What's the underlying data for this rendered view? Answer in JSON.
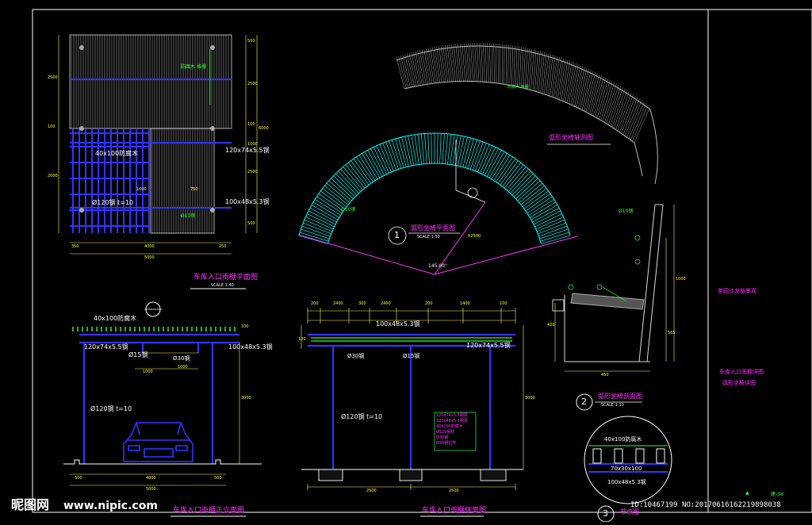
{
  "titles": {
    "plan_view": "车库入口雨棚平面图",
    "front_elevation": "车库入口雨棚正立面图",
    "side_elevation": "车库入口雨棚侧面图",
    "bench_plan": "弧形坐椅平面图",
    "bench_perspective": "弧形坐椅轴测图",
    "bench_section": "弧形坐椅剖面图",
    "detail": "节点图"
  },
  "scales": {
    "plan_view": "SCALE 1:40",
    "bench_plan": "SCALE 1:30",
    "bench_section": "SCALE 1:10"
  },
  "markers": {
    "m1": "1",
    "m2": "2",
    "m3": "3"
  },
  "plan_dims": {
    "bottom": [
      "350",
      "4000",
      "250"
    ],
    "total": "5000",
    "right": [
      "500",
      "2500",
      "100",
      "1000",
      "2500",
      "500"
    ],
    "right_total": "6000",
    "left": [
      "2500",
      "100",
      "2000"
    ],
    "inner": [
      "1600",
      "750",
      "1000",
      "1600"
    ]
  },
  "labels": {
    "beam_40x100": "40x100防腐木",
    "beam_120x74": "120x74x5.5钢",
    "beam_100x48": "100x48x5.3钢",
    "column_120": "Ø120钢 t=10",
    "rod_30": "Ø30钢",
    "rod_15": "Ø15钢",
    "rod_10": "Ø10钢",
    "small_note": "防腐木 格栅",
    "detail_70x30": "70x30x100",
    "bench_dim_radius": "R2500",
    "bench_angle": "145.00°",
    "sec_dims": [
      "450",
      "420",
      "565",
      "1000"
    ]
  },
  "front_dims": {
    "top": [
      "1000",
      "1000"
    ],
    "bottom": [
      "500",
      "4000",
      "500"
    ],
    "total": "5000",
    "height": "3000",
    "top_offset": "100"
  },
  "side_dims": {
    "top": [
      "200",
      "2400",
      "300",
      "2400",
      "200",
      "1400",
      "100"
    ],
    "bottom": [
      "2500",
      "2500"
    ],
    "height": "3000",
    "left": "100"
  },
  "side_legend": [
    "120x74x5.5钢梁",
    "100x48x5.3钢梁",
    "40x100防腐木",
    "Ø120钢柱",
    "Ø30钢",
    "Ø15钢拉杆"
  ],
  "title_block": {
    "project": "茶园沙龙施景观",
    "drawing_line1": "车库入口雨棚详图",
    "drawing_line2": "弧形坐椅详图",
    "sheet": "建-38",
    "mark": "▲"
  },
  "watermark": {
    "brand": "昵图网",
    "url": "www.nipic.com",
    "id_text": "ID:10467199 NO:20170616162219898038"
  },
  "colors": {
    "background": "#000000",
    "frame": "#ffffff",
    "steel": "#3333ff",
    "wood": "#c8c8c8",
    "bench_plan": "#00ffff",
    "text_green": "#33ff33",
    "text_magenta": "#ff33ff",
    "dim": "#ffff66"
  }
}
